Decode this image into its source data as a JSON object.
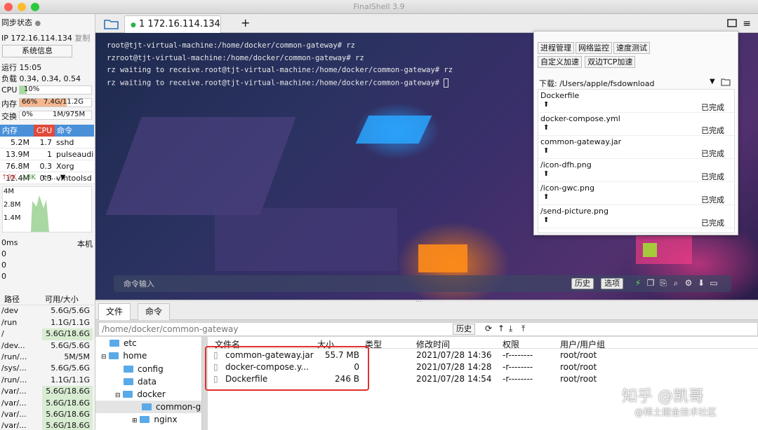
{
  "window": {
    "title": "FinalShell 3.9"
  },
  "session_tab": {
    "label": "1 172.16.114.134",
    "add": "+"
  },
  "left": {
    "sync": "同步状态",
    "ip": "IP 172.16.114.134",
    "copy": "复制",
    "sys_btn": "系统信息",
    "uptime": "运行 15:05",
    "load": "负载 0.34, 0.34, 0.54",
    "cpu_label": "CPU",
    "cpu_val": "10%",
    "cpu_fraction": 0.1,
    "mem_label": "内存",
    "mem_pct": "66%",
    "mem_val": "7.4G/11.2G",
    "mem_fraction": 0.66,
    "swap_label": "交换",
    "swap_pct": "0%",
    "swap_val": "1M/975M",
    "proc_head": [
      "内存",
      "CPU",
      "命令"
    ],
    "procs": [
      [
        "5.2M",
        "1.7",
        "sshd"
      ],
      [
        "13.9M",
        "1",
        "pulseaudi"
      ],
      [
        "76.8M",
        "0.3",
        "Xorg"
      ],
      [
        "12.4M",
        "0.3",
        "vmtoolsd"
      ]
    ],
    "net_up": "↑9K",
    "net_down": "↓3K",
    "net_if": "en... ▼",
    "net_scale": [
      "4M",
      "2.8M",
      "1.4M"
    ],
    "ping_label": "0ms",
    "ping_host": "本机",
    "ping_vals": [
      "0",
      "0",
      "0"
    ],
    "fs_head": [
      "路径",
      "可用/大小"
    ],
    "fs": [
      [
        "/dev",
        "5.6G/5.6G"
      ],
      [
        "/run",
        "1.1G/1.1G"
      ],
      [
        "/",
        "5.6G/18.6G"
      ],
      [
        "/dev...",
        "5.6G/5.6G"
      ],
      [
        "/run/...",
        "5M/5M"
      ],
      [
        "/sys/...",
        "5.6G/5.6G"
      ],
      [
        "/run/...",
        "1.1G/1.1G"
      ],
      [
        "/var/...",
        "5.6G/18.6G"
      ],
      [
        "/var/...",
        "5.6G/18.6G"
      ],
      [
        "/var/...",
        "5.6G/18.6G"
      ],
      [
        "/var/...",
        "5.6G/18.6G"
      ]
    ]
  },
  "terminal": {
    "lines": [
      "root@tjt-virtual-machine:/home/docker/common-gateway# rz",
      "rzroot@tjt-virtual-machine:/home/docker/common-gateway# rz",
      "rz waiting to receive.root@tjt-virtual-machine:/home/docker/common-gateway# rz",
      "rz waiting to receive.root@tjt-virtual-machine:/home/docker/common-gateway# "
    ],
    "cmd_placeholder": "命令输入",
    "history": "历史",
    "options": "选项"
  },
  "popup": {
    "buttons": [
      "进程管理",
      "网络监控",
      "速度测试",
      "自定义加速",
      "双边TCP加速"
    ],
    "download_label": "下载: /Users/apple/fsdownload",
    "items": [
      {
        "name": "Dockerfile",
        "status": "已完成"
      },
      {
        "name": "docker-compose.yml",
        "status": "已完成"
      },
      {
        "name": "common-gateway.jar",
        "status": "已完成"
      },
      {
        "name": "/icon-dfh.png",
        "status": "已完成"
      },
      {
        "name": "/icon-gwc.png",
        "status": "已完成"
      },
      {
        "name": "/send-picture.png",
        "status": "已完成"
      }
    ]
  },
  "bottom": {
    "tabs": [
      "文件",
      "命令"
    ],
    "path": "/home/docker/common-gateway",
    "history": "历史",
    "tree": [
      "etc",
      "home",
      "config",
      "data",
      "docker",
      "common-g",
      "nginx"
    ],
    "columns": [
      "文件名",
      "大小",
      "类型",
      "修改时间",
      "权限",
      "用户/用户组"
    ],
    "files": [
      {
        "name": "common-gateway.jar",
        "size": "55.7 MB",
        "mtime": "2021/07/28 14:36",
        "perm": "-r--------",
        "owner": "root/root"
      },
      {
        "name": "docker-compose.y...",
        "size": "0",
        "mtime": "2021/07/28 14:28",
        "perm": "-r--------",
        "owner": "root/root"
      },
      {
        "name": "Dockerfile",
        "size": "246 B",
        "mtime": "2021/07/28 14:54",
        "perm": "-r--------",
        "owner": "root/root"
      }
    ]
  },
  "watermark": {
    "line1": "知乎 @凯哥",
    "line2": "@稀土掘金技术社区"
  }
}
